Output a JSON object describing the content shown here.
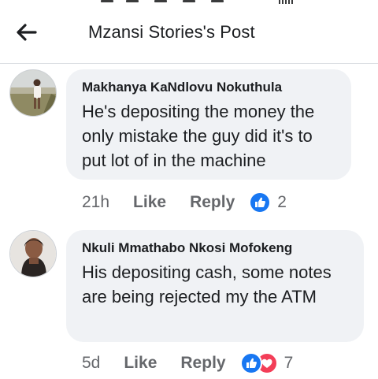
{
  "header": {
    "title": "Mzansi Stories's Post",
    "back_icon": "arrow-left-icon"
  },
  "comments": [
    {
      "author": "Makhanya KaNdlovu Nokuthula",
      "text": "He's depositing the money the only mistake the guy did it's to put lot of in the machine",
      "time": "21h",
      "like_label": "Like",
      "reply_label": "Reply",
      "reactions": [
        "like-reaction-icon"
      ],
      "reaction_count": "2"
    },
    {
      "author": "Nkuli Mmathabo Nkosi Mofokeng",
      "text": "His depositing cash, some notes are being rejected my the ATM",
      "time": "5d",
      "like_label": "Like",
      "reply_label": "Reply",
      "reactions": [
        "like-reaction-icon",
        "love-reaction-icon"
      ],
      "reaction_count": "7"
    }
  ],
  "colors": {
    "bubble": "#f0f2f5",
    "meta_text": "#65676b",
    "like_blue": "#1877f2",
    "love_red": "#f33e58"
  }
}
